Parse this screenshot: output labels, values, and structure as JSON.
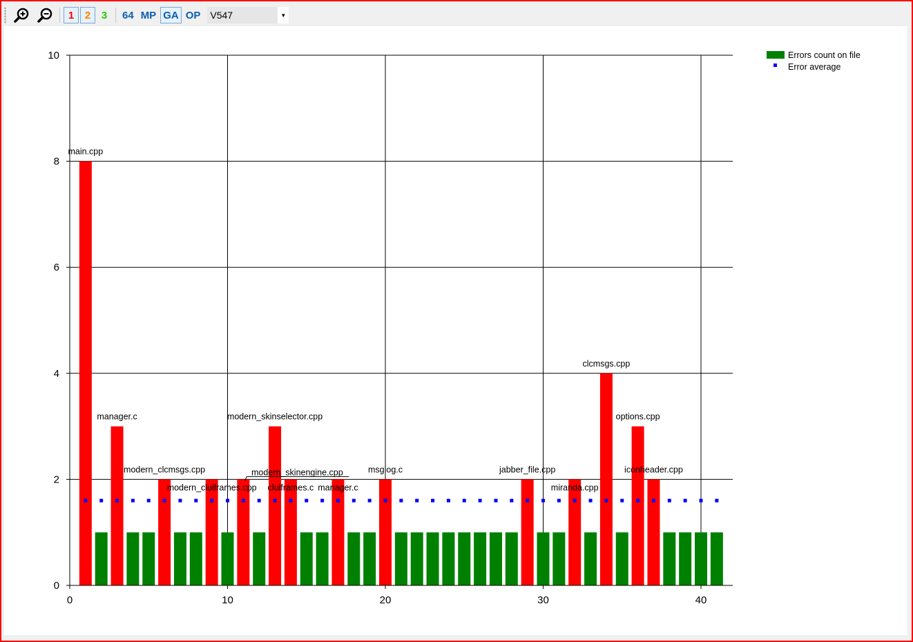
{
  "toolbar": {
    "buttons": [
      {
        "label": "1",
        "color": "#ff0000",
        "pressed": true
      },
      {
        "label": "2",
        "color": "#ff8000",
        "pressed": true
      },
      {
        "label": "3",
        "color": "#22cc00",
        "pressed": false
      },
      {
        "label": "64",
        "color": "#0b5fb0",
        "pressed": false
      },
      {
        "label": "MP",
        "color": "#0b5fb0",
        "pressed": false
      },
      {
        "label": "GA",
        "color": "#0b5fb0",
        "pressed": true
      },
      {
        "label": "OP",
        "color": "#0b5fb0",
        "pressed": false
      }
    ],
    "selected_diagnostic": "V547"
  },
  "chart_data": {
    "type": "bar",
    "xlim": [
      0,
      42
    ],
    "ylim": [
      0,
      10
    ],
    "xticks": [
      0,
      10,
      20,
      30,
      40
    ],
    "yticks": [
      0,
      2,
      4,
      6,
      8,
      10
    ],
    "grid": true,
    "legend_position": "top-right",
    "colors": {
      "normal": "#008000",
      "above_average": "#ff0000",
      "average": "#0000ff"
    },
    "series": [
      {
        "name": "Errors count on file",
        "x": [
          1,
          2,
          3,
          4,
          5,
          6,
          7,
          8,
          9,
          10,
          11,
          12,
          13,
          14,
          15,
          16,
          17,
          18,
          19,
          20,
          21,
          22,
          23,
          24,
          25,
          26,
          27,
          28,
          29,
          30,
          31,
          32,
          33,
          34,
          35,
          36,
          37,
          38,
          39,
          40,
          41
        ],
        "values": [
          8,
          1,
          3,
          1,
          1,
          2,
          1,
          1,
          2,
          1,
          2,
          1,
          3,
          2,
          1,
          1,
          2,
          1,
          1,
          2,
          1,
          1,
          1,
          1,
          1,
          1,
          1,
          1,
          2,
          1,
          1,
          2,
          1,
          4,
          1,
          3,
          2,
          1,
          1,
          1,
          1
        ]
      },
      {
        "name": "Error average",
        "value": 1.6
      }
    ],
    "annotations": [
      {
        "x": 1,
        "y": 8,
        "text": "main.cpp"
      },
      {
        "x": 3,
        "y": 3,
        "text": "manager.c"
      },
      {
        "x": 6,
        "y": 2,
        "text": "modern_clcmsgs.cpp"
      },
      {
        "x": 9,
        "y": 2,
        "text": "modern_cluiframes.cpp"
      },
      {
        "x": 11,
        "y": 2,
        "text": "modern_skinengine.cpp"
      },
      {
        "x": 13,
        "y": 3,
        "text": "modern_skinselector.cpp"
      },
      {
        "x": 14,
        "y": 2,
        "text": "cluiframes.c"
      },
      {
        "x": 17,
        "y": 2,
        "text": "manager.c"
      },
      {
        "x": 20,
        "y": 2,
        "text": "msglog.c"
      },
      {
        "x": 29,
        "y": 2,
        "text": "jabber_file.cpp"
      },
      {
        "x": 32,
        "y": 2,
        "text": "miranda.cpp"
      },
      {
        "x": 34,
        "y": 4,
        "text": "clcmsgs.cpp"
      },
      {
        "x": 36,
        "y": 3,
        "text": "options.cpp"
      },
      {
        "x": 37,
        "y": 2,
        "text": "iconheader.cpp"
      }
    ]
  }
}
